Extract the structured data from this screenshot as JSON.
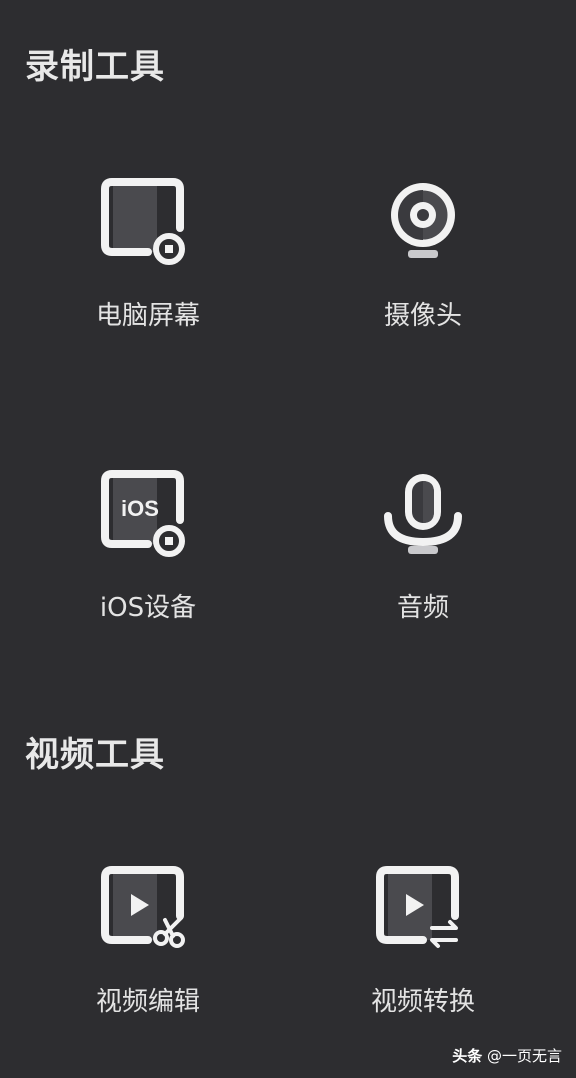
{
  "sections": {
    "record": {
      "title": "录制工具",
      "items": [
        {
          "label": "电脑屏幕",
          "icon": "screen-record-icon"
        },
        {
          "label": "摄像头",
          "icon": "webcam-icon"
        },
        {
          "label": "iOS设备",
          "icon": "ios-device-record-icon",
          "icon_text": "iOS"
        },
        {
          "label": "音频",
          "icon": "microphone-icon"
        }
      ]
    },
    "video": {
      "title": "视频工具",
      "items": [
        {
          "label": "视频编辑",
          "icon": "video-edit-icon"
        },
        {
          "label": "视频转换",
          "icon": "video-convert-icon"
        }
      ]
    }
  },
  "watermark": {
    "brand": "头条",
    "handle": "@一页无言"
  },
  "colors": {
    "background": "#2d2d30",
    "icon_stroke": "#f2f2f2",
    "icon_shade": "#4a4a4e"
  }
}
